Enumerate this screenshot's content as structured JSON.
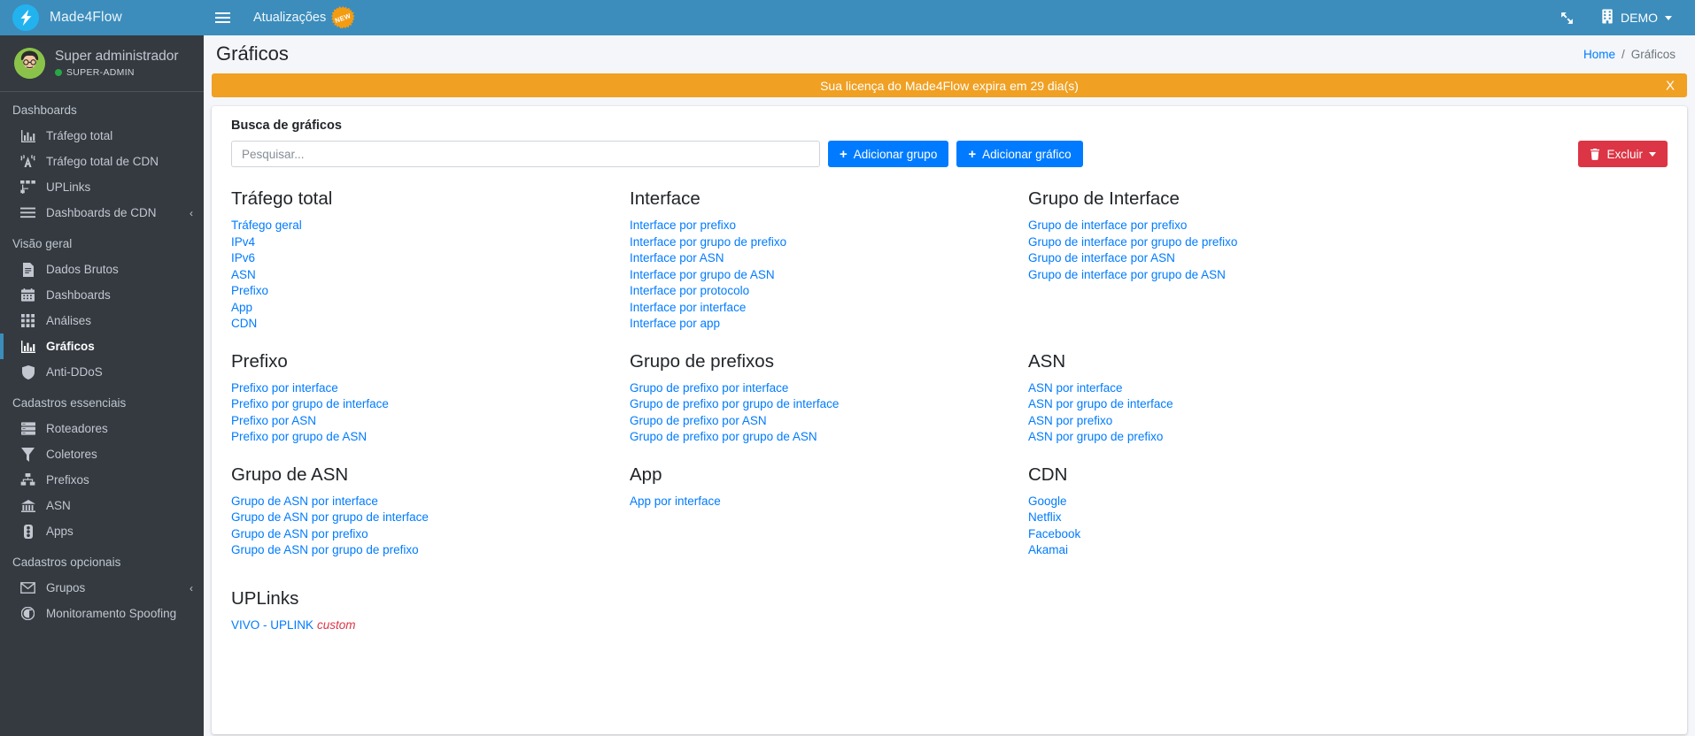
{
  "topbar": {
    "brand_name": "Made4Flow",
    "hamburger_icon": "hamburger-menu-icon",
    "updates_label": "Atualizações",
    "new_badge_text": "NEW",
    "fullscreen_icon": "expand-arrows-icon",
    "company_icon": "building-icon",
    "company_label": "DEMO"
  },
  "sidebar": {
    "user": {
      "name": "Super administrador",
      "role": "SUPER-ADMIN",
      "avatar_icon": "user-avatar"
    },
    "sections": [
      {
        "label": "Dashboards",
        "items": [
          {
            "label": "Tráfego total",
            "icon": "bar-chart-icon",
            "active": false,
            "arrow": ""
          },
          {
            "label": "Tráfego total de CDN",
            "icon": "broadcast-tower-icon",
            "active": false,
            "arrow": ""
          },
          {
            "label": "UPLinks",
            "icon": "sitemap-icon",
            "active": false,
            "arrow": ""
          },
          {
            "label": "Dashboards de CDN",
            "icon": "bars-icon",
            "active": false,
            "arrow": "‹"
          }
        ]
      },
      {
        "label": "Visão geral",
        "items": [
          {
            "label": "Dados Brutos",
            "icon": "file-lines-icon",
            "active": false,
            "arrow": ""
          },
          {
            "label": "Dashboards",
            "icon": "calendar-icon",
            "active": false,
            "arrow": ""
          },
          {
            "label": "Análises",
            "icon": "grid-icon",
            "active": false,
            "arrow": ""
          },
          {
            "label": "Gráficos",
            "icon": "bar-chart-icon",
            "active": true,
            "arrow": ""
          },
          {
            "label": "Anti-DDoS",
            "icon": "shield-icon",
            "active": false,
            "arrow": ""
          }
        ]
      },
      {
        "label": "Cadastros essenciais",
        "items": [
          {
            "label": "Roteadores",
            "icon": "server-icon",
            "active": false,
            "arrow": ""
          },
          {
            "label": "Coletores",
            "icon": "filter-icon",
            "active": false,
            "arrow": ""
          },
          {
            "label": "Prefixos",
            "icon": "network-nodes-icon",
            "active": false,
            "arrow": ""
          },
          {
            "label": "ASN",
            "icon": "landmark-icon",
            "active": false,
            "arrow": ""
          },
          {
            "label": "Apps",
            "icon": "traffic-light-icon",
            "active": false,
            "arrow": ""
          }
        ]
      },
      {
        "label": "Cadastros opcionais",
        "items": [
          {
            "label": "Grupos",
            "icon": "envelope-icon",
            "active": false,
            "arrow": "‹"
          },
          {
            "label": "Monitoramento Spoofing",
            "icon": "spoofing-icon",
            "active": false,
            "arrow": ""
          }
        ]
      }
    ]
  },
  "header": {
    "title": "Gráficos",
    "breadcrumb": {
      "home": "Home",
      "separator": "/",
      "current": "Gráficos"
    }
  },
  "banner": {
    "message": "Sua licença do Made4Flow expira em 29 dia(s)",
    "close_label": "X",
    "color": "#f0a022"
  },
  "search": {
    "label": "Busca de gráficos",
    "placeholder": "Pesquisar...",
    "value": "",
    "add_group_label": "Adicionar grupo",
    "add_chart_label": "Adicionar gráfico",
    "delete_label": "Excluir",
    "plus_icon": "plus-icon",
    "trash_icon": "trash-icon",
    "accent_color": "#007bff",
    "danger_color": "#dc3545"
  },
  "groups": [
    {
      "title": "Tráfego total",
      "links": [
        {
          "label": "Tráfego geral"
        },
        {
          "label": "IPv4"
        },
        {
          "label": "IPv6"
        },
        {
          "label": "ASN"
        },
        {
          "label": "Prefixo"
        },
        {
          "label": "App"
        },
        {
          "label": "CDN"
        }
      ]
    },
    {
      "title": "Interface",
      "links": [
        {
          "label": "Interface por prefixo"
        },
        {
          "label": "Interface por grupo de prefixo"
        },
        {
          "label": "Interface por ASN"
        },
        {
          "label": "Interface por grupo de ASN"
        },
        {
          "label": "Interface por protocolo"
        },
        {
          "label": "Interface por interface"
        },
        {
          "label": "Interface por app"
        }
      ]
    },
    {
      "title": "Grupo de Interface",
      "links": [
        {
          "label": "Grupo de interface por prefixo"
        },
        {
          "label": "Grupo de interface por grupo de prefixo"
        },
        {
          "label": "Grupo de interface por ASN"
        },
        {
          "label": "Grupo de interface por grupo de ASN"
        }
      ]
    },
    {
      "title": "Prefixo",
      "links": [
        {
          "label": "Prefixo por interface"
        },
        {
          "label": "Prefixo por grupo de interface"
        },
        {
          "label": "Prefixo por ASN"
        },
        {
          "label": "Prefixo por grupo de ASN"
        }
      ]
    },
    {
      "title": "Grupo de prefixos",
      "links": [
        {
          "label": "Grupo de prefixo por interface"
        },
        {
          "label": "Grupo de prefixo por grupo de interface"
        },
        {
          "label": "Grupo de prefixo por ASN"
        },
        {
          "label": "Grupo de prefixo por grupo de ASN"
        }
      ]
    },
    {
      "title": "ASN",
      "links": [
        {
          "label": "ASN por interface"
        },
        {
          "label": "ASN por grupo de interface"
        },
        {
          "label": "ASN por prefixo"
        },
        {
          "label": "ASN por grupo de prefixo"
        }
      ]
    },
    {
      "title": "Grupo de ASN",
      "links": [
        {
          "label": "Grupo de ASN por interface"
        },
        {
          "label": "Grupo de ASN por grupo de interface"
        },
        {
          "label": "Grupo de ASN por prefixo"
        },
        {
          "label": "Grupo de ASN por grupo de prefixo"
        }
      ]
    },
    {
      "title": "App",
      "links": [
        {
          "label": "App por interface"
        }
      ]
    },
    {
      "title": "CDN",
      "links": [
        {
          "label": "Google"
        },
        {
          "label": "Netflix"
        },
        {
          "label": "Facebook"
        },
        {
          "label": "Akamai"
        }
      ]
    },
    {
      "title": "UPLinks",
      "links": [
        {
          "label": "VIVO - UPLINK",
          "tag": "custom"
        }
      ]
    }
  ]
}
